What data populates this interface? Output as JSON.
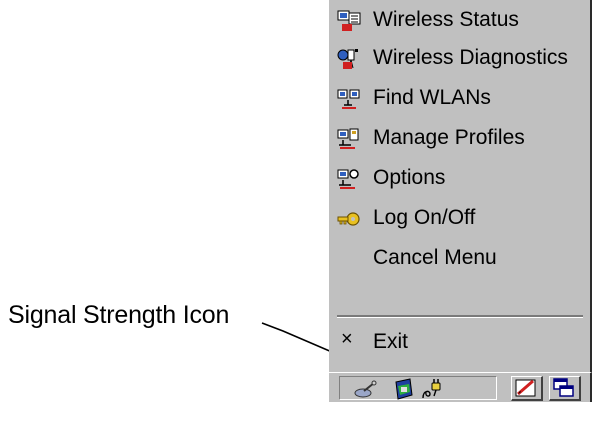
{
  "annotation": {
    "label": "Signal Strength Icon"
  },
  "menu": {
    "items": [
      {
        "label": "Wireless Status",
        "icon": "wireless-status-icon"
      },
      {
        "label": "Wireless Diagnostics",
        "icon": "wireless-diagnostics-icon"
      },
      {
        "label": "Find WLANs",
        "icon": "find-wlans-icon"
      },
      {
        "label": "Manage Profiles",
        "icon": "manage-profiles-icon"
      },
      {
        "label": "Options",
        "icon": "options-icon"
      },
      {
        "label": "Log On/Off",
        "icon": "key-icon"
      },
      {
        "label": "Cancel Menu",
        "icon": ""
      }
    ],
    "exit": {
      "label": "Exit",
      "glyph": "×"
    }
  },
  "taskbar": {
    "tray_icons": [
      "network-icon",
      "signal-strength-icon",
      "power-plug-icon"
    ],
    "buttons": [
      "input-panel-icon",
      "switch-windows-icon"
    ]
  },
  "colors": {
    "menu_bg": "#c0c0c0",
    "frame": "#2a2a2a"
  }
}
